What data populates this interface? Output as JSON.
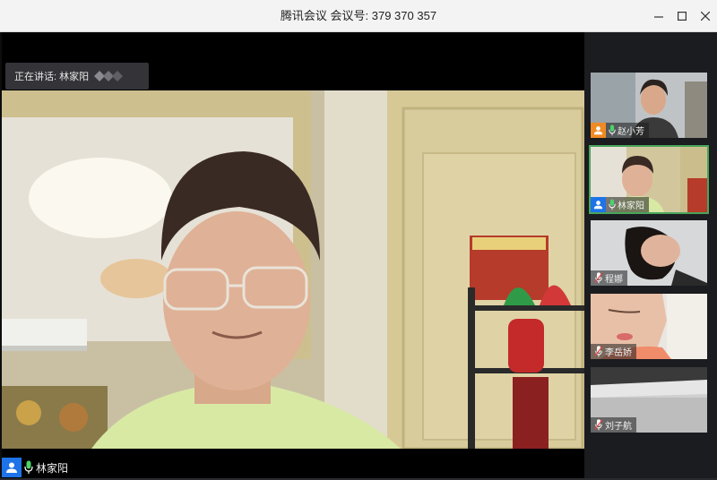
{
  "window": {
    "title": "腾讯会议  会议号: 379 370 357"
  },
  "speaker_banner": {
    "text": "正在讲话: 林家阳"
  },
  "main_video": {
    "name": "林家阳"
  },
  "participants": [
    {
      "name": "赵小芳",
      "badge_color": "#f08a24",
      "mic": "on"
    },
    {
      "name": "林家阳",
      "badge_color": "#1e73e8",
      "mic": "on"
    },
    {
      "name": "程娜",
      "badge_color": "",
      "mic": "muted"
    },
    {
      "name": "李岳娇",
      "badge_color": "",
      "mic": "muted"
    },
    {
      "name": "刘子航",
      "badge_color": "",
      "mic": "muted"
    }
  ],
  "colors": {
    "accent": "#1e73e8",
    "active_outline": "#4aa45a",
    "mic_on": "#4bd36a",
    "mic_muted": "#e64545"
  }
}
